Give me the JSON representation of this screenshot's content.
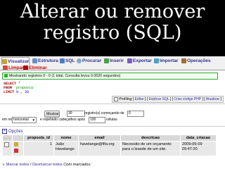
{
  "slide": {
    "title_line1": "Alterar ou remover",
    "title_line2": "registro (SQL)"
  },
  "tabs": {
    "row1": [
      "Visualizar",
      "Estrutura",
      "SQL",
      "Procurar",
      "Inserir",
      "Exportar",
      "Importar",
      "Operações"
    ],
    "row2": [
      "Limpar",
      "Eliminar"
    ]
  },
  "result_message": "Mostrando registros 0 - 0 (1 total, Consulta levou 0.0020 segundos)",
  "query": {
    "line1_kw": "SELECT",
    "line1_rest": " *",
    "line2_kw": "FROM",
    "line2_rest": " `proposta`",
    "line3_kw": "LIMIT",
    "line3_rest": " 0 , 30"
  },
  "query_links": {
    "profiling": "Profiling",
    "edit": "Editar",
    "explain": "Explicar SQL",
    "create_php": "Criar código PHP",
    "refresh": "Atualizar"
  },
  "nav": {
    "show_button": "Mostrar",
    "rows_value": "30",
    "rows_text": "registro(s) começando de",
    "start_value": "0",
    "mode_prefix": "em modo",
    "mode_value": "horizontal",
    "repeat_text": "e repetindo cabeçalhos após",
    "repeat_value": "100",
    "cells_text": "células"
  },
  "options_label": "Opções",
  "columns": [
    "proposta_id",
    "nome",
    "email",
    "descricao",
    "data_criacao"
  ],
  "rows": [
    {
      "proposta_id": "1",
      "nome": "Juão Havelange",
      "email": "havelange@fifa.org",
      "descricao": "Necessito de um orçamento para o leasde de um site.",
      "data_criacao": "2009-05-09 09:47:20"
    }
  ],
  "footer": {
    "mark_all": "Marcar todos",
    "separator": " / ",
    "unmark_all": "Desmarcar todos",
    "with_marked": "Com marcados:"
  }
}
